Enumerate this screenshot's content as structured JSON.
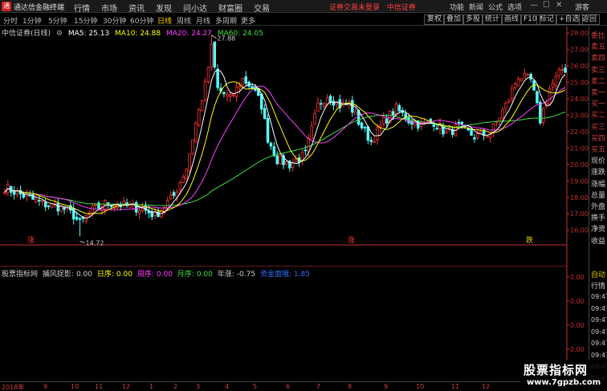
{
  "titlebar": {
    "app_title": "通达信金融终端",
    "logo": "通",
    "menus": [
      "行情",
      "市场",
      "资讯",
      "发现",
      "问小达",
      "财富圈",
      "交易"
    ],
    "warning": "证券交易未登录",
    "broker": "中信证券",
    "right_menus": [
      "功能",
      "新闻",
      "公式",
      "选项"
    ],
    "user": "游客"
  },
  "toolbar": {
    "timeframes": [
      "分时",
      "1分钟",
      "5分钟",
      "15分钟",
      "30分钟",
      "60分钟",
      "日线",
      "周线",
      "月线",
      "多周期",
      "更多"
    ],
    "active_timeframe": "日线",
    "right_tools": [
      "复权",
      "叠加",
      "多股",
      "统计",
      "画线",
      "F10",
      "标记",
      "+自选",
      "返回"
    ]
  },
  "legend": {
    "symbol": "中信证券(日线)",
    "ma5_label": "MA5: 25.13",
    "ma10_label": "MA10: 24.88",
    "ma20_label": "MA20: 24.27",
    "ma60_label": "MA60: 24.05"
  },
  "colors": {
    "up": "#ff3232",
    "down": "#54fcfc",
    "ma5": "#ffffff",
    "ma10": "#ffff00",
    "ma20": "#ff40ff",
    "ma60": "#40e040",
    "axis": "#c83030"
  },
  "annotations": {
    "high_label": "27.88",
    "low_label": "14.72",
    "signal_labels": [
      "涨",
      "涨",
      "跌"
    ]
  },
  "chart_data": {
    "type": "candlestick",
    "ylim": [
      15.3,
      28.4
    ],
    "price_ticks": [
      "28.00",
      "27.00",
      "26.00",
      "25.00",
      "24.00",
      "23.00",
      "22.00",
      "21.00",
      "20.00",
      "19.00",
      "18.00",
      "17.00",
      "16.00"
    ],
    "keypoints": [
      [
        0,
        18.6
      ],
      [
        6,
        18.1
      ],
      [
        12,
        17.6
      ],
      [
        18,
        17.4
      ],
      [
        22,
        16.9
      ],
      [
        24,
        16.4
      ],
      [
        28,
        17.2
      ],
      [
        33,
        17.7
      ],
      [
        38,
        17.5
      ],
      [
        44,
        17.3
      ],
      [
        48,
        16.9
      ],
      [
        54,
        18.1
      ],
      [
        58,
        19.8
      ],
      [
        61,
        22.5
      ],
      [
        64,
        24.8
      ],
      [
        66,
        27.1
      ],
      [
        68,
        24.6
      ],
      [
        72,
        24.0
      ],
      [
        76,
        25.2
      ],
      [
        79,
        24.7
      ],
      [
        82,
        23.6
      ],
      [
        84,
        21.6
      ],
      [
        87,
        20.3
      ],
      [
        91,
        20.0
      ],
      [
        96,
        20.6
      ],
      [
        100,
        23.6
      ],
      [
        103,
        24.2
      ],
      [
        107,
        23.6
      ],
      [
        110,
        23.7
      ],
      [
        113,
        22.6
      ],
      [
        117,
        21.4
      ],
      [
        121,
        22.6
      ],
      [
        125,
        23.4
      ],
      [
        129,
        22.7
      ],
      [
        133,
        22.4
      ],
      [
        137,
        22.6
      ],
      [
        141,
        21.9
      ],
      [
        145,
        22.3
      ],
      [
        150,
        21.7
      ],
      [
        155,
        21.9
      ],
      [
        160,
        23.6
      ],
      [
        164,
        25.4
      ],
      [
        168,
        25.1
      ],
      [
        171,
        22.7
      ],
      [
        174,
        24.6
      ],
      [
        178,
        25.8
      ]
    ],
    "high_annotation": {
      "x": 66,
      "value": 27.88
    },
    "low_annotation": {
      "x": 24,
      "value": 14.72
    },
    "bars": 180,
    "indicator": {
      "name": "股票指标网",
      "values": [
        {
          "label": "捕风捉影:",
          "value": "0.00"
        },
        {
          "label": "日序:",
          "value": "0.00"
        },
        {
          "label": "周序:",
          "value": "0.00"
        },
        {
          "label": "月序:",
          "value": "0.00"
        },
        {
          "label": "年涨:",
          "value": "-0.75"
        }
      ],
      "extra_label": "资金面哦: 1.85",
      "ticks": [
        "0.00",
        "0.00",
        "0.00",
        "0.00",
        "0.00"
      ]
    },
    "x_ticks": [
      "2018年",
      "9",
      "10",
      "11",
      "12",
      "1",
      "2",
      "3",
      "4",
      "5",
      "6",
      "7",
      "8",
      "9",
      "10",
      "11",
      "12"
    ]
  },
  "right_panel": {
    "labels": [
      "委比",
      "卖五",
      "卖四",
      "卖三",
      "卖二",
      "卖一",
      "买一",
      "买二",
      "买三",
      "买四",
      "买五",
      "现价",
      "涨跌",
      "涨幅",
      "总量",
      "外盘",
      "换手",
      "净资",
      "收益"
    ],
    "lower_labels": [
      "自动",
      "行情"
    ],
    "times": [
      "09:47",
      "09:47",
      "09:47",
      "09:47",
      "09:47",
      "09:47",
      "09:47",
      "09:47"
    ]
  },
  "watermark": {
    "title": "股票指标网",
    "url": "www.7gpzb.com"
  }
}
